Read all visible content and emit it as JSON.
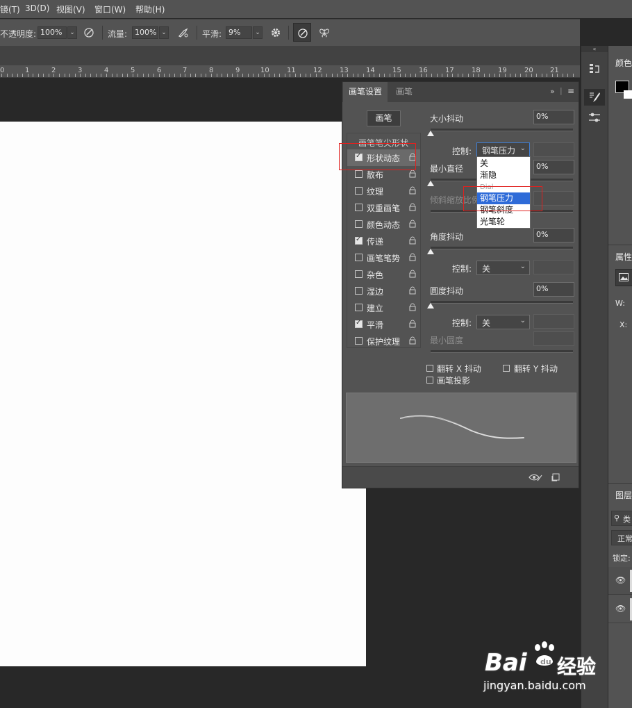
{
  "menubar": {
    "items": [
      "镜(T)",
      "3D(D)",
      "视图(V)",
      "窗口(W)",
      "帮助(H)"
    ]
  },
  "options_bar": {
    "opacity_label": "不透明度:",
    "opacity_value": "100%",
    "flow_label": "流量:",
    "flow_value": "100%",
    "smoothing_label": "平滑:",
    "smoothing_value": "9%"
  },
  "ruler": {
    "numbers": [
      "0",
      "1",
      "2",
      "3",
      "4",
      "5",
      "6",
      "7",
      "8",
      "9",
      "10",
      "11",
      "12",
      "13",
      "14",
      "15",
      "16",
      "17",
      "18",
      "19",
      "20",
      "21"
    ]
  },
  "brush_panel": {
    "tabs": [
      {
        "label": "画笔设置",
        "active": true
      },
      {
        "label": "画笔",
        "active": false
      }
    ],
    "brushes_button": "画笔",
    "list_header": "画笔笔尖形状",
    "options": [
      {
        "label": "形状动态",
        "checked": true,
        "selected": true
      },
      {
        "label": "散布",
        "checked": false
      },
      {
        "label": "纹理",
        "checked": false
      },
      {
        "label": "双重画笔",
        "checked": false
      },
      {
        "label": "颜色动态",
        "checked": false
      },
      {
        "label": "传递",
        "checked": true
      },
      {
        "label": "画笔笔势",
        "checked": false
      },
      {
        "label": "杂色",
        "checked": false
      },
      {
        "label": "湿边",
        "checked": false
      },
      {
        "label": "建立",
        "checked": false
      },
      {
        "label": "平滑",
        "checked": true
      },
      {
        "label": "保护纹理",
        "checked": false
      }
    ],
    "size_jitter": {
      "label": "大小抖动",
      "value": "0%",
      "slider_fraction": 0
    },
    "size_control": {
      "label": "控制:",
      "value": "钢笔压力"
    },
    "min_diameter": {
      "label": "最小直径",
      "value": "0%",
      "slider_fraction": 0
    },
    "tilt_scale": {
      "label": "倾斜缩放比例"
    },
    "angle_jitter": {
      "label": "角度抖动",
      "value": "0%",
      "slider_fraction": 0
    },
    "angle_control": {
      "label": "控制:",
      "value": "关"
    },
    "roundness_jitter": {
      "label": "圆度抖动",
      "value": "0%",
      "slider_fraction": 0
    },
    "roundness_control": {
      "label": "控制:",
      "value": "关"
    },
    "min_roundness": {
      "label": "最小圆度"
    },
    "flip_x": {
      "label": "翻转 X 抖动",
      "checked": false
    },
    "flip_y": {
      "label": "翻转 Y 抖动",
      "checked": false
    },
    "brush_projection": {
      "label": "画笔投影",
      "checked": false
    }
  },
  "control_dropdown": {
    "options": [
      "关",
      "渐隐",
      "Dial",
      "钢笔压力",
      "钢笔斜度",
      "光笔轮"
    ],
    "selected": "钢笔压力"
  },
  "right_panels": {
    "color_label": "颜色",
    "properties_label": "属性",
    "w_label": "W:",
    "x_label": "X:",
    "layers_label": "图层",
    "search_label": "类",
    "blend_mode": "正常",
    "lock_label": "锁定:"
  },
  "watermark": {
    "brand": "Bai",
    "brand_cn": "经验",
    "url": "jingyan.baidu.com"
  },
  "colors": {
    "ui_dark": "#535353",
    "highlight_blue": "#2e6bd8",
    "annotation_red": "#e0211f"
  }
}
